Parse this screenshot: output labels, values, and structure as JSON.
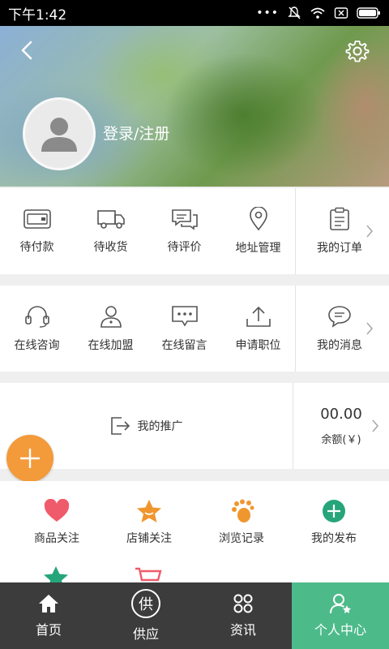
{
  "status_bar": {
    "time": "下午1:42"
  },
  "header": {
    "login_text": "登录/注册"
  },
  "orders": {
    "items": [
      {
        "label": "待付款",
        "icon": "wallet-icon"
      },
      {
        "label": "待收货",
        "icon": "truck-icon"
      },
      {
        "label": "待评价",
        "icon": "chat-bubbles-icon"
      },
      {
        "label": "地址管理",
        "icon": "location-pin-icon"
      }
    ],
    "last": {
      "label": "我的订单",
      "icon": "clipboard-icon"
    }
  },
  "services": {
    "items": [
      {
        "label": "在线咨询",
        "icon": "headset-icon"
      },
      {
        "label": "在线加盟",
        "icon": "user-icon"
      },
      {
        "label": "在线留言",
        "icon": "message-dots-icon"
      },
      {
        "label": "申请职位",
        "icon": "upload-icon"
      }
    ],
    "last": {
      "label": "我的消息",
      "icon": "speech-bubble-icon"
    }
  },
  "promo": {
    "label": "我的推广",
    "balance_value": "00.00",
    "balance_label": "余额(￥)"
  },
  "favorites": {
    "items": [
      {
        "label": "商品关注",
        "icon": "heart-icon",
        "color": "#ef5b6a"
      },
      {
        "label": "店铺关注",
        "icon": "star-icon",
        "color": "#f0962f"
      },
      {
        "label": "浏览记录",
        "icon": "footprints-icon",
        "color": "#f0962f"
      },
      {
        "label": "我的发布",
        "icon": "plus-circle-icon",
        "color": "#26a57a"
      }
    ]
  },
  "tabbar": {
    "tabs": [
      {
        "label": "首页",
        "icon": "home-icon"
      },
      {
        "label": "供应",
        "icon": "supply-icon",
        "icon_text": "供"
      },
      {
        "label": "资讯",
        "icon": "grid-icon"
      },
      {
        "label": "个人中心",
        "icon": "user-star-icon",
        "active": true
      }
    ]
  },
  "colors": {
    "accent": "#4dba8a",
    "fab": "#f39a3a",
    "tabbar": "#3c3c3c"
  }
}
